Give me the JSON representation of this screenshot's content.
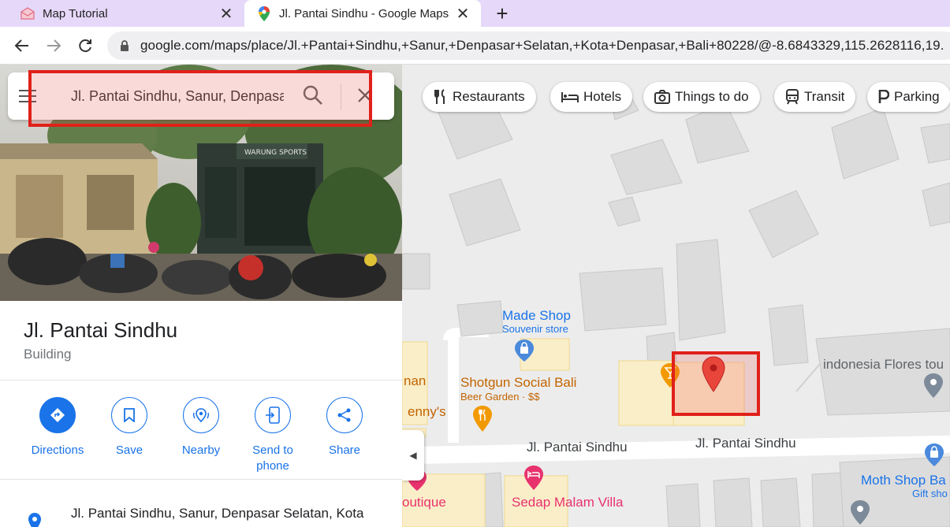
{
  "browser": {
    "tabs": [
      {
        "title": "Map Tutorial",
        "icon": "mail-icon",
        "active": false
      },
      {
        "title": "Jl. Pantai Sindhu - Google Maps",
        "icon": "google-maps-icon",
        "active": true
      }
    ],
    "new_tab_label": "+",
    "url": "google.com/maps/place/Jl.+Pantai+Sindhu,+Sanur,+Denpasar+Selatan,+Kota+Denpasar,+Bali+80228/@-8.6843329,115.2628116,19."
  },
  "search": {
    "query": "Jl. Pantai Sindhu, Sanur, Denpasar Selatan"
  },
  "place": {
    "title": "Jl. Pantai Sindhu",
    "type": "Building",
    "address": "Jl. Pantai Sindhu, Sanur, Denpasar Selatan, Kota"
  },
  "actions": [
    {
      "label": "Directions",
      "icon": "directions-icon"
    },
    {
      "label": "Save",
      "icon": "bookmark-icon"
    },
    {
      "label": "Nearby",
      "icon": "nearby-icon"
    },
    {
      "label": "Send to phone",
      "icon": "send-to-phone-icon"
    },
    {
      "label": "Share",
      "icon": "share-icon"
    }
  ],
  "map": {
    "chips": [
      {
        "label": "Restaurants",
        "icon": "restaurant-icon"
      },
      {
        "label": "Hotels",
        "icon": "hotel-icon"
      },
      {
        "label": "Things to do",
        "icon": "camera-icon"
      },
      {
        "label": "Transit",
        "icon": "transit-icon"
      },
      {
        "label": "Parking",
        "icon": "parking-icon"
      }
    ],
    "pois": {
      "made_shop": {
        "name": "Made Shop",
        "category": "Souvenir store"
      },
      "shotgun": {
        "name": "Shotgun Social Bali",
        "category": "Beer Garden · $$"
      },
      "indonesia_flores": {
        "name": "indonesia Flores tou"
      },
      "moth_shop": {
        "name": "Moth Shop Ba",
        "category": "Gift sho"
      },
      "sedap_malam": {
        "name": "Sedap Malam Villa"
      },
      "partial_nan": {
        "name": "nan"
      },
      "partial_jenny": {
        "name": "enny's"
      },
      "partial_boutique": {
        "name": "outique"
      }
    },
    "roads": [
      "Jl. Pantai Sindhu",
      "Jl. Pantai Sindhu"
    ]
  },
  "colors": {
    "accent": "#1a73e8",
    "highlight": "#e0201a",
    "pin": "#ea4335",
    "shop_blue": "#1a73e8",
    "food_orange": "#e37400",
    "hotel_pink": "#e8326e"
  }
}
